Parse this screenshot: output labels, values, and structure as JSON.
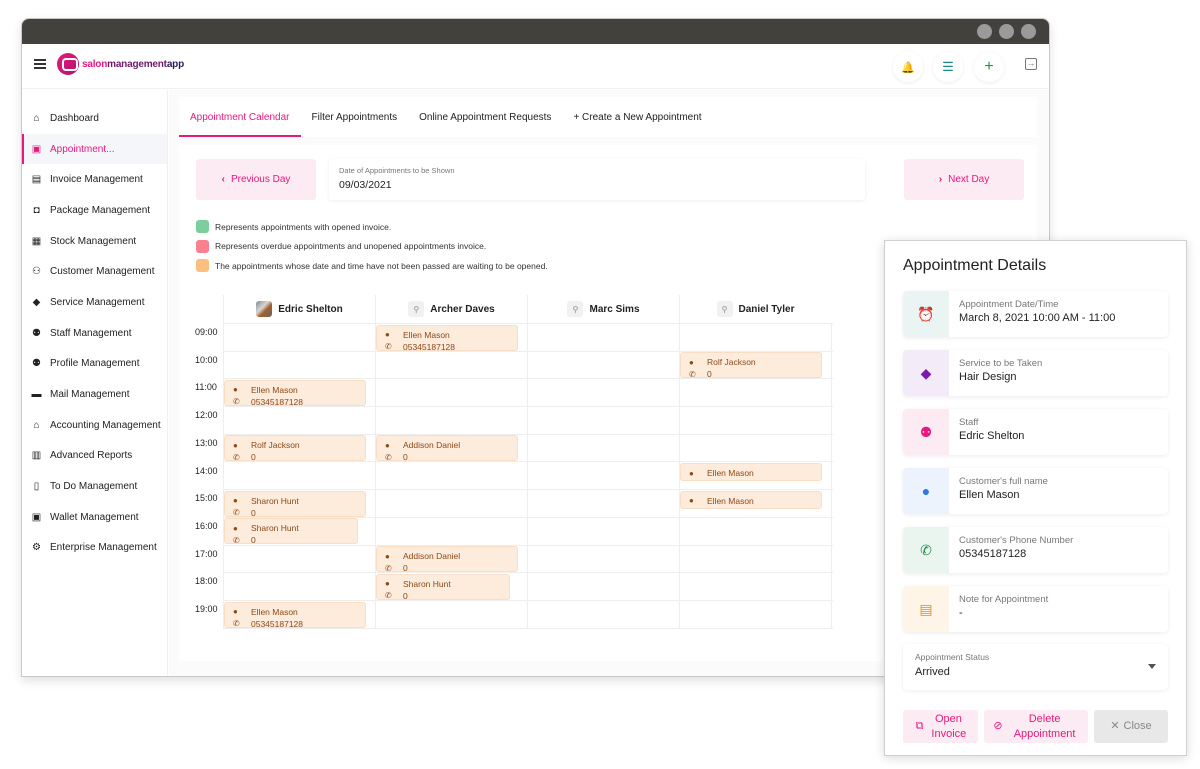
{
  "app": {
    "logo": {
      "part1": "salon",
      "part2": "management",
      "part3": "app"
    }
  },
  "header": {
    "buttons": [
      {
        "name": "notifications",
        "icon": "bell-icon",
        "glyph": "🔔",
        "color": "#f28c00"
      },
      {
        "name": "menu-collapse",
        "icon": "menu-collapse-icon",
        "glyph": "☰",
        "color": "#1a8a8a"
      },
      {
        "name": "add",
        "icon": "plus-icon",
        "glyph": "+",
        "color": "#1a9a4a"
      }
    ],
    "logout_glyph": "→"
  },
  "sidebar": {
    "items": [
      {
        "label": "Dashboard",
        "icon": "home-icon",
        "glyph": "⌂",
        "active": false
      },
      {
        "label": "Appointment...",
        "icon": "calendar-icon",
        "glyph": "▣",
        "active": true
      },
      {
        "label": "Invoice Management",
        "icon": "invoice-icon",
        "glyph": "▤",
        "active": false
      },
      {
        "label": "Package Management",
        "icon": "package-icon",
        "glyph": "◘",
        "active": false
      },
      {
        "label": "Stock Management",
        "icon": "store-icon",
        "glyph": "▦",
        "active": false
      },
      {
        "label": "Customer Management",
        "icon": "people-icon",
        "glyph": "⚇",
        "active": false
      },
      {
        "label": "Service Management",
        "icon": "layers-icon",
        "glyph": "◆",
        "active": false
      },
      {
        "label": "Staff Management",
        "icon": "staff-icon",
        "glyph": "⚉",
        "active": false
      },
      {
        "label": "Profile Management",
        "icon": "profile-icon",
        "glyph": "⚉",
        "active": false
      },
      {
        "label": "Mail Management",
        "icon": "message-icon",
        "glyph": "▬",
        "active": false
      },
      {
        "label": "Accounting Management",
        "icon": "bank-icon",
        "glyph": "⌂",
        "active": false
      },
      {
        "label": "Advanced Reports",
        "icon": "chart-icon",
        "glyph": "▥",
        "active": false
      },
      {
        "label": "To Do Management",
        "icon": "todo-icon",
        "glyph": "▯",
        "active": false
      },
      {
        "label": "Wallet Management",
        "icon": "wallet-icon",
        "glyph": "▣",
        "active": false
      },
      {
        "label": "Enterprise Management",
        "icon": "gear-icon",
        "glyph": "⚙",
        "active": false
      }
    ]
  },
  "tabs": [
    {
      "label": "Appointment Calendar",
      "active": true
    },
    {
      "label": "Filter Appointments",
      "active": false
    },
    {
      "label": "Online Appointment Requests",
      "active": false
    },
    {
      "label": "+ Create a New Appointment",
      "active": false
    }
  ],
  "date_nav": {
    "previous_label": "Previous Day",
    "next_label": "Next Day",
    "date_label": "Date of Appointments to be Shown",
    "date_value": "09/03/2021"
  },
  "legend": [
    {
      "color": "#7bcf9c",
      "text": "Represents appointments with opened invoice."
    },
    {
      "color": "#f7818f",
      "text": "Represents overdue appointments and unopened appointments invoice."
    },
    {
      "color": "#fbbf80",
      "text": "The appointments whose date and time have not been passed are waiting to be opened."
    }
  ],
  "calendar": {
    "hours": [
      "09:00",
      "10:00",
      "11:00",
      "12:00",
      "13:00",
      "14:00",
      "15:00",
      "16:00",
      "17:00",
      "18:00",
      "19:00"
    ],
    "staff": [
      {
        "name": "Edric Shelton",
        "has_photo": true
      },
      {
        "name": "Archer Daves",
        "has_photo": false
      },
      {
        "name": "Marc Sims",
        "has_photo": false
      },
      {
        "name": "Daniel Tyler",
        "has_photo": false
      }
    ],
    "appointments": [
      {
        "staff": 1,
        "hour": 0,
        "customer": "Ellen Mason",
        "phone": "05345187128",
        "wide": true
      },
      {
        "staff": 3,
        "hour": 1,
        "customer": "Rolf Jackson",
        "phone": "0",
        "wide": true
      },
      {
        "staff": 0,
        "hour": 2,
        "customer": "Ellen Mason",
        "phone": "05345187128",
        "wide": true
      },
      {
        "staff": 0,
        "hour": 4,
        "customer": "Rolf Jackson",
        "phone": "0",
        "wide": true
      },
      {
        "staff": 1,
        "hour": 4,
        "customer": "Addison Daniel",
        "phone": "0",
        "wide": true
      },
      {
        "staff": 3,
        "hour": 5,
        "customer": "Ellen Mason",
        "phone": "",
        "wide": true
      },
      {
        "staff": 0,
        "hour": 6,
        "customer": "Sharon Hunt",
        "phone": "0",
        "wide": true
      },
      {
        "staff": 3,
        "hour": 6,
        "customer": "Ellen Mason",
        "phone": "",
        "wide": true
      },
      {
        "staff": 0,
        "hour": 7,
        "customer": "Sharon Hunt",
        "phone": "0",
        "wide": false
      },
      {
        "staff": 1,
        "hour": 8,
        "customer": "Addison Daniel",
        "phone": "0",
        "wide": true
      },
      {
        "staff": 1,
        "hour": 9,
        "customer": "Sharon Hunt",
        "phone": "0",
        "wide": false
      },
      {
        "staff": 0,
        "hour": 10,
        "customer": "Ellen Mason",
        "phone": "05345187128",
        "wide": true
      }
    ]
  },
  "details": {
    "title": "Appointment Details",
    "fields": [
      {
        "label": "Appointment Date/Time",
        "value": "March 8, 2021 10:00 AM - 11:00",
        "icon": "alarm-clock-icon",
        "glyph": "⏰",
        "bg": "#eaf5f3",
        "color": "#168a7a"
      },
      {
        "label": "Service to be Taken",
        "value": "Hair Design",
        "icon": "layers-icon",
        "glyph": "◆",
        "bg": "#f3ecf8",
        "color": "#7a1ab0"
      },
      {
        "label": "Staff",
        "value": "Edric Shelton",
        "icon": "staff-check-icon",
        "glyph": "⚉",
        "bg": "#fdebf3",
        "color": "#e6197d"
      },
      {
        "label": "Customer's full name",
        "value": "Ellen Mason",
        "icon": "person-icon",
        "glyph": "●",
        "bg": "#ecf3fd",
        "color": "#2a7ae0"
      },
      {
        "label": "Customer's Phone Number",
        "value": "05345187128",
        "icon": "phone-icon",
        "glyph": "✆",
        "bg": "#eaf5ef",
        "color": "#1a8a4a"
      },
      {
        "label": "Note for Appointment",
        "value": "-",
        "icon": "document-icon",
        "glyph": "▤",
        "bg": "#fff4e8",
        "color": "#f28c00"
      }
    ],
    "status_label": "Appointment Status",
    "status_value": "Arrived",
    "buttons": {
      "open_invoice": "Open Invoice",
      "delete_appointment": "Delete Appointment",
      "close": "Close"
    }
  }
}
